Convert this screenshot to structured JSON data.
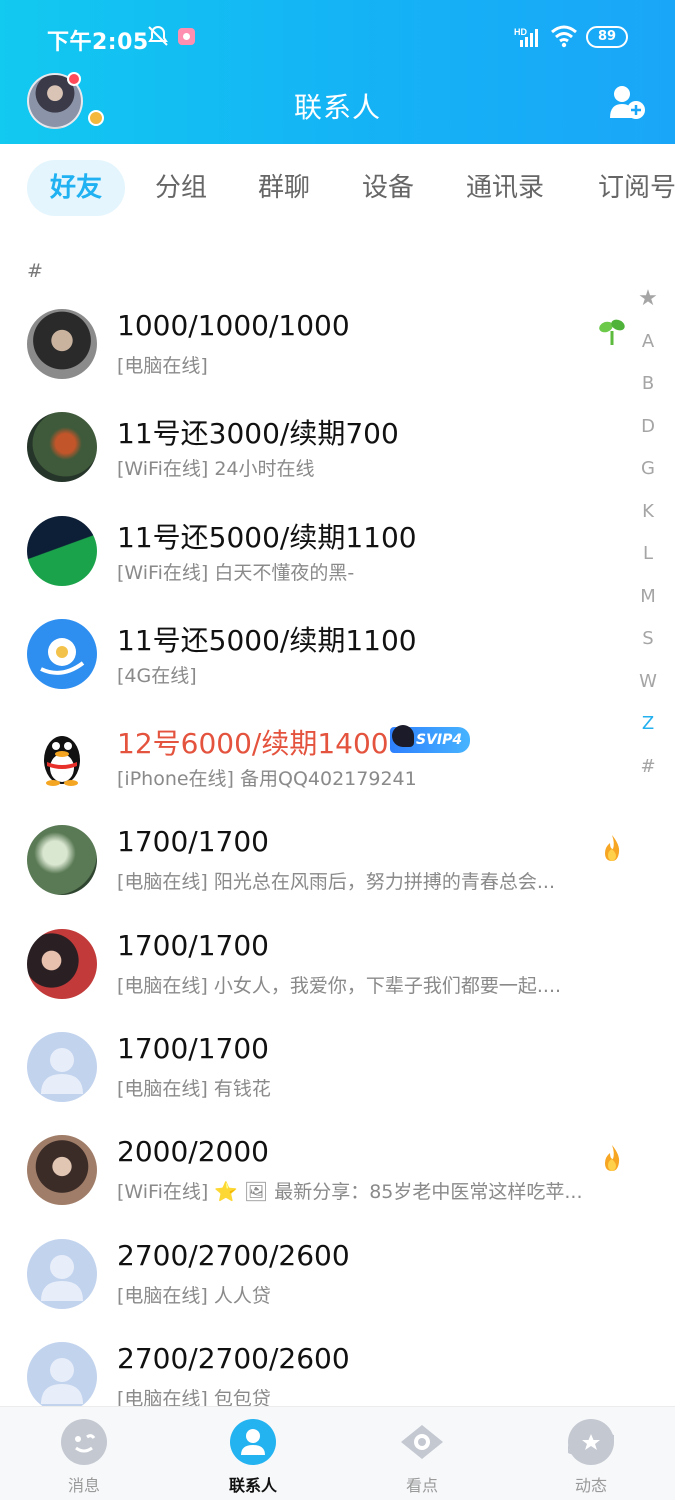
{
  "status_bar": {
    "time": "下午2:05",
    "battery": "89"
  },
  "header": {
    "title": "联系人"
  },
  "tabs": [
    {
      "label": "好友",
      "active": true
    },
    {
      "label": "分组"
    },
    {
      "label": "群聊"
    },
    {
      "label": "设备"
    },
    {
      "label": "通讯录"
    },
    {
      "label": "订阅号"
    }
  ],
  "section_header": "#",
  "contacts": [
    {
      "name": "1000/1000/1000",
      "status": "[电脑在线]",
      "right_icon": "sprout-icon"
    },
    {
      "name": "11号还3000/续期700",
      "status": "[WiFi在线] 24小时在线"
    },
    {
      "name": "11号还5000/续期1100",
      "status": "[WiFi在线] 白天不懂夜的黑-"
    },
    {
      "name": "11号还5000/续期1100",
      "status": "[4G在线]"
    },
    {
      "name": "12号6000/续期1400",
      "status": "[iPhone在线] 备用QQ402179241",
      "vip": "SVIP4",
      "name_color": "#e4533e"
    },
    {
      "name": "1700/1700",
      "status": "[电脑在线] 阳光总在风雨后，努力拼搏的青春总会...",
      "right_icon": "flame-icon"
    },
    {
      "name": "1700/1700",
      "status": "[电脑在线] 小女人，我爱你，下辈子我们都要一起...."
    },
    {
      "name": "1700/1700",
      "status": "[电脑在线] 有钱花"
    },
    {
      "name": "2000/2000",
      "status": "[WiFi在线] ⭐ 🖼 最新分享：85岁老中医常这样吃苹...",
      "right_icon": "flame-icon"
    },
    {
      "name": "2700/2700/2600",
      "status": "[电脑在线] 人人贷"
    },
    {
      "name": "2700/2700/2600",
      "status": "[电脑在线] 包包贷"
    }
  ],
  "index": [
    "★",
    "A",
    "B",
    "D",
    "G",
    "K",
    "L",
    "M",
    "S",
    "W",
    "Z",
    "#"
  ],
  "index_active": "Z",
  "bottom_nav": [
    {
      "label": "消息",
      "icon": "message-icon"
    },
    {
      "label": "联系人",
      "icon": "contacts-icon",
      "active": true
    },
    {
      "label": "看点",
      "icon": "eye-icon"
    },
    {
      "label": "动态",
      "icon": "planet-icon"
    }
  ],
  "colors": {
    "header_start": "#12c9f0",
    "header_end": "#1aa6f8",
    "accent": "#1fb1f1",
    "vip_name": "#e4533e"
  }
}
